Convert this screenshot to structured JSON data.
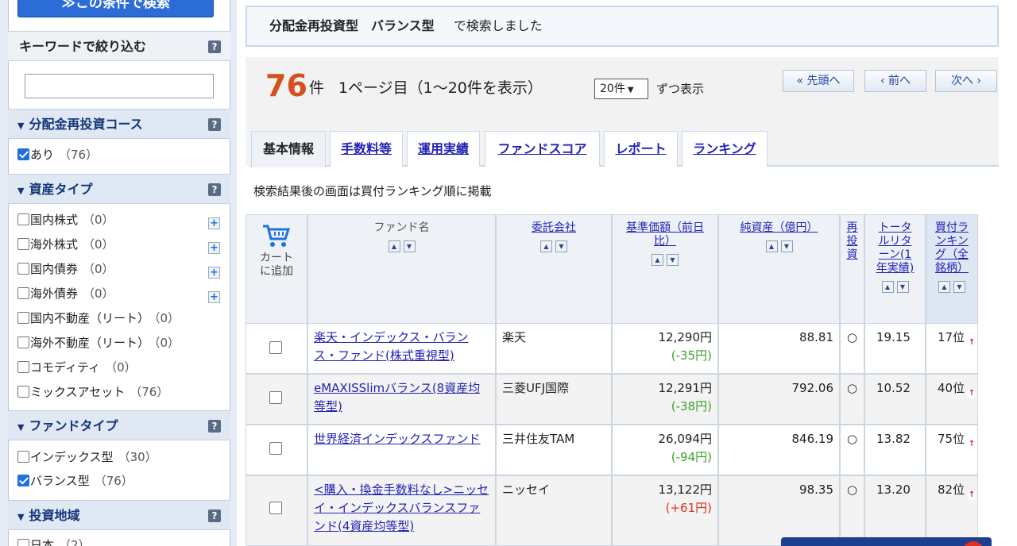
{
  "sidebar": {
    "search_button": "≫この条件で検索",
    "keyword": {
      "title": "キーワードで絞り込む",
      "value": ""
    },
    "sections": [
      {
        "title": "分配金再投資コース",
        "items": [
          {
            "label": "あり",
            "count": "（76）",
            "checked": true
          }
        ]
      },
      {
        "title": "資産タイプ",
        "items": [
          {
            "label": "国内株式",
            "count": "（0）",
            "checked": false
          },
          {
            "label": "海外株式",
            "count": "（0）",
            "checked": false
          },
          {
            "label": "国内債券",
            "count": "（0）",
            "checked": false
          },
          {
            "label": "海外債券",
            "count": "（0）",
            "checked": false
          },
          {
            "label": "国内不動産（リート）",
            "count": "（0）",
            "checked": false
          },
          {
            "label": "海外不動産（リート）",
            "count": "（0）",
            "checked": false
          },
          {
            "label": "コモディティ",
            "count": "（0）",
            "checked": false
          },
          {
            "label": "ミックスアセット",
            "count": "（76）",
            "checked": false
          }
        ]
      },
      {
        "title": "ファンドタイプ",
        "items": [
          {
            "label": "インデックス型",
            "count": "（30）",
            "checked": false
          },
          {
            "label": "バランス型",
            "count": "（76）",
            "checked": true
          }
        ]
      },
      {
        "title": "投資地域",
        "items": [
          {
            "label": "日本",
            "count": "（2）",
            "checked": false
          }
        ]
      }
    ]
  },
  "condition": {
    "terms": "分配金再投資型　バランス型",
    "suffix": "で検索しました"
  },
  "results": {
    "count": "76",
    "unit": "件",
    "page_info": "1ページ目（1～20件を表示）",
    "per_page": "20件",
    "per_page_suffix": "ずつ表示",
    "first": "« 先頭へ",
    "prev": "‹ 前へ",
    "next": "次へ ›"
  },
  "tabs": [
    "基本情報",
    "手数料等",
    "運用実績",
    "ファンドスコア",
    "レポート",
    "ランキング"
  ],
  "note": "検索結果後の画面は買付ランキング順に掲載",
  "table": {
    "headers": {
      "cart": "カートに追加",
      "name": "ファンド名",
      "company": "委託会社",
      "price": "基準価額（前日比）",
      "assets": "純資産（億円）",
      "reinvest": "再投資",
      "return": "トータルリターン(1年実績)",
      "ranking": "買付ランキング（全銘柄）"
    },
    "rows": [
      {
        "name": "楽天・インデックス・バランス・ファンド(株式重視型)",
        "company": "楽天",
        "price": "12,290円",
        "change": "(-35円)",
        "assets": "88.81",
        "reinvest": "○",
        "return": "19.15",
        "rank": "17位"
      },
      {
        "name": "eMAXISSlimバランス(8資産均等型)",
        "company": "三菱UFJ国際",
        "price": "12,291円",
        "change": "(-38円)",
        "assets": "792.06",
        "reinvest": "○",
        "return": "10.52",
        "rank": "40位"
      },
      {
        "name": "世界経済インデックスファンド",
        "company": "三井住友TAM",
        "price": "26,094円",
        "change": "(-94円)",
        "assets": "846.19",
        "reinvest": "○",
        "return": "13.82",
        "rank": "75位"
      },
      {
        "name": "<購入・換金手数料なし>ニッセイ・インデックスバランスファンド(4資産均等型)",
        "company": "ニッセイ",
        "price": "13,122円",
        "change": "(+61円)",
        "assets": "98.35",
        "reinvest": "○",
        "return": "13.20",
        "rank": "82位"
      }
    ]
  },
  "icons": {
    "cart": "cart-icon",
    "help": "help-icon",
    "expand": "plus-icon",
    "sort_up": "sort-up-icon",
    "sort_down": "sort-down-icon",
    "rank_up": "rank-up-icon"
  },
  "colors": {
    "accent": "#d4501e",
    "link": "#2323b5",
    "negative": "#3aa12b",
    "positive": "#e0301e",
    "header": "#13357a"
  }
}
